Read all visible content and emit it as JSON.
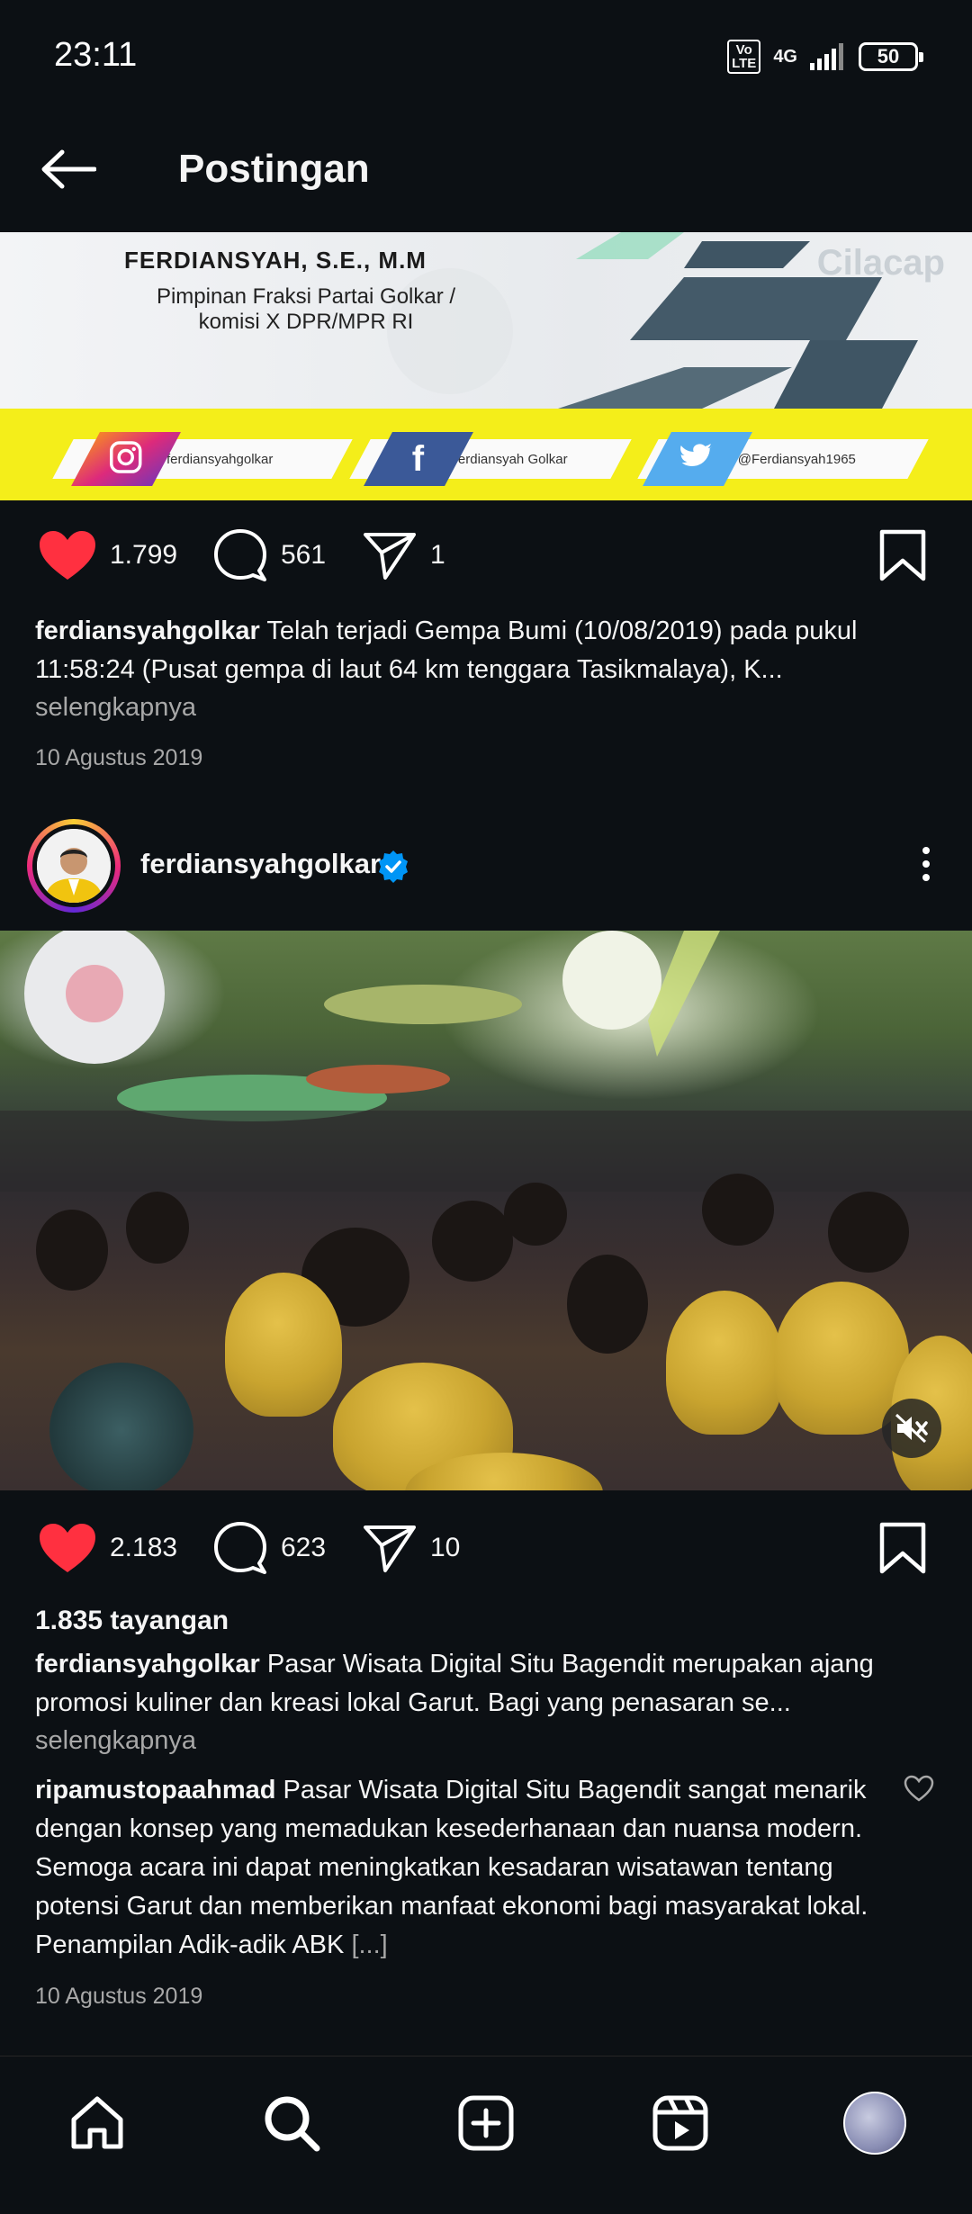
{
  "status_bar": {
    "time": "23:11",
    "volte": "Vo LTE",
    "network": "4G",
    "battery": "50"
  },
  "header": {
    "title": "Postingan",
    "back_icon": "arrow-left-icon"
  },
  "post1": {
    "banner": {
      "name": "FERDIANSYAH, S.E., M.M",
      "subtitle": "Pimpinan Fraksi Partai Golkar / komisi X DPR/MPR RI",
      "place": "Cilacap",
      "instagram": "@ferdiansyahgolkar",
      "facebook": "Ferdiansyah Golkar",
      "twitter": "@Ferdiansyah1965"
    },
    "likes": "1.799",
    "comments": "561",
    "shares": "1",
    "caption_user": "ferdiansyahgolkar",
    "caption_text": " Telah terjadi Gempa Bumi (10/08/2019) pada pukul 11:58:24 (Pusat gempa di laut 64 km tenggara Tasikmalaya), K...",
    "more": "selengkapnya",
    "date": "10 Agustus 2019"
  },
  "post2": {
    "username": "ferdiansyahgolkar",
    "likes": "2.183",
    "comments": "623",
    "shares": "10",
    "views": "1.835 tayangan",
    "caption_user": "ferdiansyahgolkar",
    "caption_text": " Pasar Wisata Digital Situ Bagendit merupakan ajang promosi kuliner dan kreasi lokal Garut. Bagi yang penasaran se...",
    "more": "selengkapnya",
    "comment_user": "ripamustopaahmad",
    "comment_text": " Pasar Wisata Digital Situ Bagendit sangat menarik dengan konsep yang memadukan kesederhanaan dan nuansa modern. Semoga acara ini dapat meningkatkan kesadaran wisatawan tentang potensi Garut dan memberikan manfaat ekonomi bagi masyarakat lokal. Penampilan Adik-adik ABK ",
    "comment_more": "[...]",
    "date": "10 Agustus 2019"
  },
  "colors": {
    "background": "#0c1014",
    "like_red": "#ff3040",
    "verified_blue": "#0095f6",
    "banner_yellow": "#f4ee1a",
    "muted_text": "#a8a8a8"
  },
  "bottom_nav": [
    "home-icon",
    "search-icon",
    "create-icon",
    "reels-icon",
    "profile-avatar"
  ]
}
